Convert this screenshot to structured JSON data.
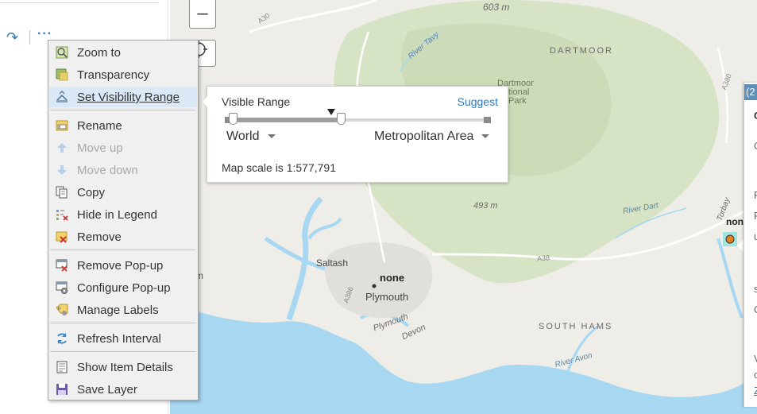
{
  "left_panel": {
    "redo_icon": "↷",
    "more_icon": "···"
  },
  "map": {
    "labels": {
      "elev_top": "603 m",
      "dartmoor": "DARTMOOR",
      "np_1": "Dartmoor",
      "np_2": "National",
      "np_3": "Park",
      "elev_mid": "493 m",
      "river_tavy": "River Tavy",
      "river_dart": "River Dart",
      "river_avon": "River Avon",
      "saltash": "Saltash",
      "none_label": "none",
      "plymouth": "Plymouth",
      "plymouth_sound": "Plymouth",
      "devon": "Devon",
      "south_hams": "SOUTH HAMS",
      "torbay": "Torbay",
      "none_right": "non",
      "a30": "A30",
      "a380": "A380",
      "a38": "A38",
      "a386": "A386",
      "left_m": "m"
    },
    "controls": {
      "zoom_out": "–"
    }
  },
  "range_popup": {
    "title": "Visible Range",
    "suggest": "Suggest",
    "min_scale": "World",
    "max_scale": "Metropolitan Area",
    "scale_text": "Map scale is 1:577,791"
  },
  "context_menu": {
    "items": [
      {
        "label": "Zoom to",
        "icon": "zoom-to-icon",
        "disabled": false
      },
      {
        "label": "Transparency",
        "icon": "transparency-icon",
        "disabled": false
      },
      {
        "label": "Set Visibility Range",
        "icon": "visibility-range-icon",
        "disabled": false
      },
      {
        "label": "Rename",
        "icon": "rename-icon",
        "disabled": false
      },
      {
        "label": "Move up",
        "icon": "arrow-up-icon",
        "disabled": true
      },
      {
        "label": "Move down",
        "icon": "arrow-down-icon",
        "disabled": true
      },
      {
        "label": "Copy",
        "icon": "copy-icon",
        "disabled": false
      },
      {
        "label": "Hide in Legend",
        "icon": "hide-legend-icon",
        "disabled": false
      },
      {
        "label": "Remove",
        "icon": "remove-icon",
        "disabled": false
      },
      {
        "label": "Remove Pop-up",
        "icon": "remove-popup-icon",
        "disabled": false
      },
      {
        "label": "Configure Pop-up",
        "icon": "configure-popup-icon",
        "disabled": false
      },
      {
        "label": "Manage Labels",
        "icon": "manage-labels-icon",
        "disabled": false
      },
      {
        "label": "Refresh Interval",
        "icon": "refresh-icon",
        "disabled": false
      },
      {
        "label": "Show Item Details",
        "icon": "item-details-icon",
        "disabled": false
      },
      {
        "label": "Save Layer",
        "icon": "save-icon",
        "disabled": false
      }
    ]
  },
  "side_popup": {
    "tab": "(2",
    "lines": [
      "C",
      "C",
      "F",
      "F",
      "u",
      "s",
      "C",
      "V",
      "c",
      "Z"
    ]
  },
  "colors": {
    "accent": "#2e7ab9",
    "menu_bg": "#f0f0f0",
    "highlight": "#dbe8f5",
    "water": "#a8d7f2",
    "park": "#d6e3c4"
  }
}
